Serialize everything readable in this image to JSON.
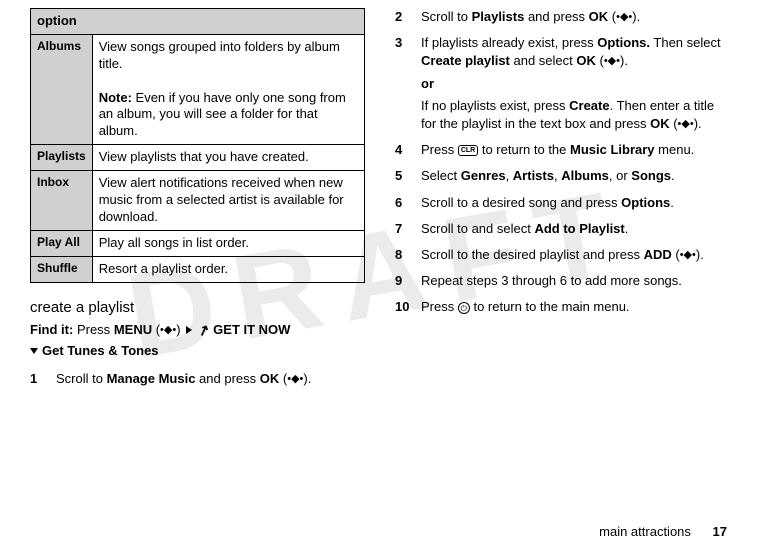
{
  "watermark": "DRAFT",
  "table": {
    "header": "option",
    "rows": [
      {
        "name": "Albums",
        "desc": "View songs grouped into folders by album title.",
        "note_label": "Note:",
        "note": " Even if you have only one song from an album, you will see a folder for that album."
      },
      {
        "name": "Playlists",
        "desc": "View playlists that you have created."
      },
      {
        "name": "Inbox",
        "desc": "View alert notifications received when new music from a selected artist is available for download."
      },
      {
        "name": "Play All",
        "desc": "Play all songs in list order."
      },
      {
        "name": "Shuffle",
        "desc": "Resort a playlist order."
      }
    ]
  },
  "section_title": "create a playlist",
  "findit": {
    "label": "Find it:",
    "press": "Press",
    "menu": "MENU",
    "getitnow": "GET IT NOW",
    "gt": "Get Tunes & Tones"
  },
  "steps_left": [
    {
      "n": "1",
      "pre": "Scroll to ",
      "b1": "Manage Music",
      "mid": " and press ",
      "b2": "OK",
      "tail_dot": true
    }
  ],
  "steps_right": [
    {
      "n": "2",
      "pre": "Scroll to ",
      "b1": "Playlists",
      "mid": " and press ",
      "b2": "OK",
      "tail_dot": true
    },
    {
      "n": "3",
      "line1_pre": "If playlists already exist, press ",
      "line1_b": "Options.",
      "line1_post": " Then select ",
      "line1_b2": "Create playlist",
      "line1_post2": " and select ",
      "line1_b3": "OK",
      "line1_dot": true,
      "or": "or",
      "line2_pre": "If no playlists exist, press ",
      "line2_b": "Create",
      "line2_post": ". Then enter a title for the playlist in the text box and press ",
      "line2_b2": "OK",
      "line2_dot": true
    },
    {
      "n": "4",
      "pre": "Press ",
      "key": "CLR",
      "mid": " to return to the ",
      "b1": "Music Library",
      "post": " menu."
    },
    {
      "n": "5",
      "pre": "Select ",
      "b1": "Genres",
      "c": ", ",
      "b2": "Artists",
      "c2": ", ",
      "b3": "Albums",
      "c3": ", or ",
      "b4": "Songs",
      "post": "."
    },
    {
      "n": "6",
      "pre": "Scroll to a desired song and press ",
      "b1": "Options",
      "post": "."
    },
    {
      "n": "7",
      "pre": "Scroll to and select ",
      "b1": "Add to Playlist",
      "post": "."
    },
    {
      "n": "8",
      "pre": "Scroll to the desired playlist and press ",
      "b1": "ADD",
      "tail_dot": true
    },
    {
      "n": "9",
      "pre": "Repeat steps 3 through 6 to add more songs."
    },
    {
      "n": "10",
      "pre": "Press ",
      "pwr": true,
      "post": " to return to the main menu."
    }
  ],
  "footer": {
    "label": "main attractions",
    "page": "17"
  }
}
